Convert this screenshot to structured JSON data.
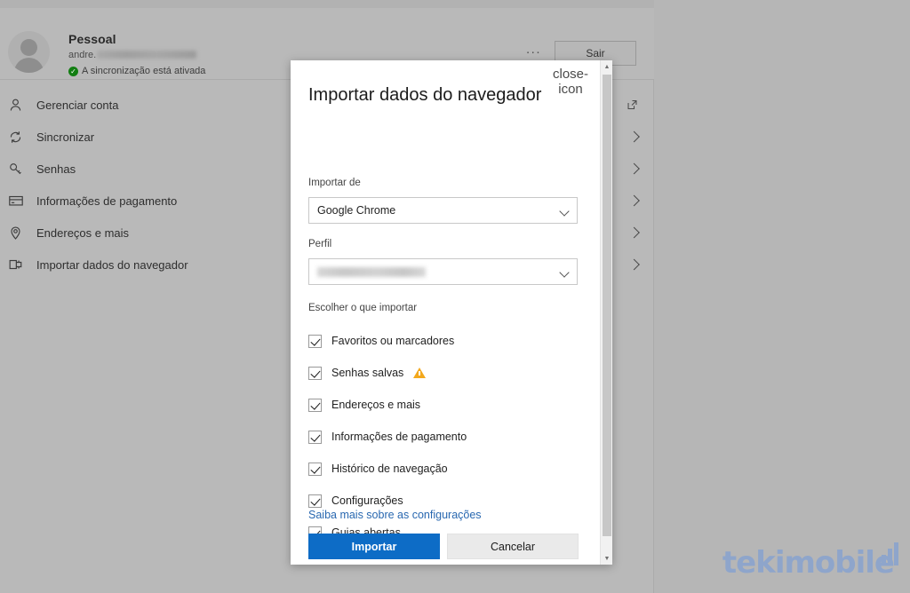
{
  "account": {
    "name": "Pessoal",
    "email_prefix": "andre.",
    "email_redacted": "██████████████",
    "sync_status": "A sincronização está ativada",
    "sync_icon": "check-circle-icon",
    "more_label": "...",
    "signout_label": "Sair"
  },
  "settings_list": [
    {
      "label": "Gerenciar conta",
      "icon": "person-icon",
      "right_icon": "external-link-icon"
    },
    {
      "label": "Sincronizar",
      "icon": "sync-icon",
      "right_icon": "chevron-right-icon"
    },
    {
      "label": "Senhas",
      "icon": "key-icon",
      "right_icon": "chevron-right-icon"
    },
    {
      "label": "Informações de pagamento",
      "icon": "credit-card-icon",
      "right_icon": "chevron-right-icon"
    },
    {
      "label": "Endereços e mais",
      "icon": "location-pin-icon",
      "right_icon": "chevron-right-icon"
    },
    {
      "label": "Importar dados do navegador",
      "icon": "import-icon",
      "right_icon": "chevron-right-icon"
    }
  ],
  "dialog": {
    "title": "Importar dados do navegador",
    "close_icon": "close-icon",
    "import_from_label": "Importar de",
    "import_from_value": "Google Chrome",
    "profile_label": "Perfil",
    "profile_value_redacted": "██████████",
    "choose_label": "Escolher o que importar",
    "items": [
      {
        "label": "Favoritos ou marcadores",
        "checked": true,
        "warning": false
      },
      {
        "label": "Senhas salvas",
        "checked": true,
        "warning": true
      },
      {
        "label": "Endereços e mais",
        "checked": true,
        "warning": false
      },
      {
        "label": "Informações de pagamento",
        "checked": true,
        "warning": false
      },
      {
        "label": "Histórico de navegação",
        "checked": true,
        "warning": false
      },
      {
        "label": "Configurações",
        "checked": true,
        "warning": false
      },
      {
        "label": "Guias abertas",
        "checked": true,
        "warning": false
      }
    ],
    "learn_more": "Saiba mais sobre as configurações",
    "import_button": "Importar",
    "cancel_button": "Cancelar",
    "scroll_up_icon": "caret-up-icon",
    "scroll_down_icon": "caret-down-icon"
  },
  "watermark": {
    "text": "tekimobile",
    "color": "#7f9fd4"
  },
  "colors": {
    "primary_button": "#0d6cc6",
    "link": "#2968b0",
    "warning": "#f3a81c",
    "sync_green": "#127e12",
    "page_bg": "#b9b9b9"
  }
}
